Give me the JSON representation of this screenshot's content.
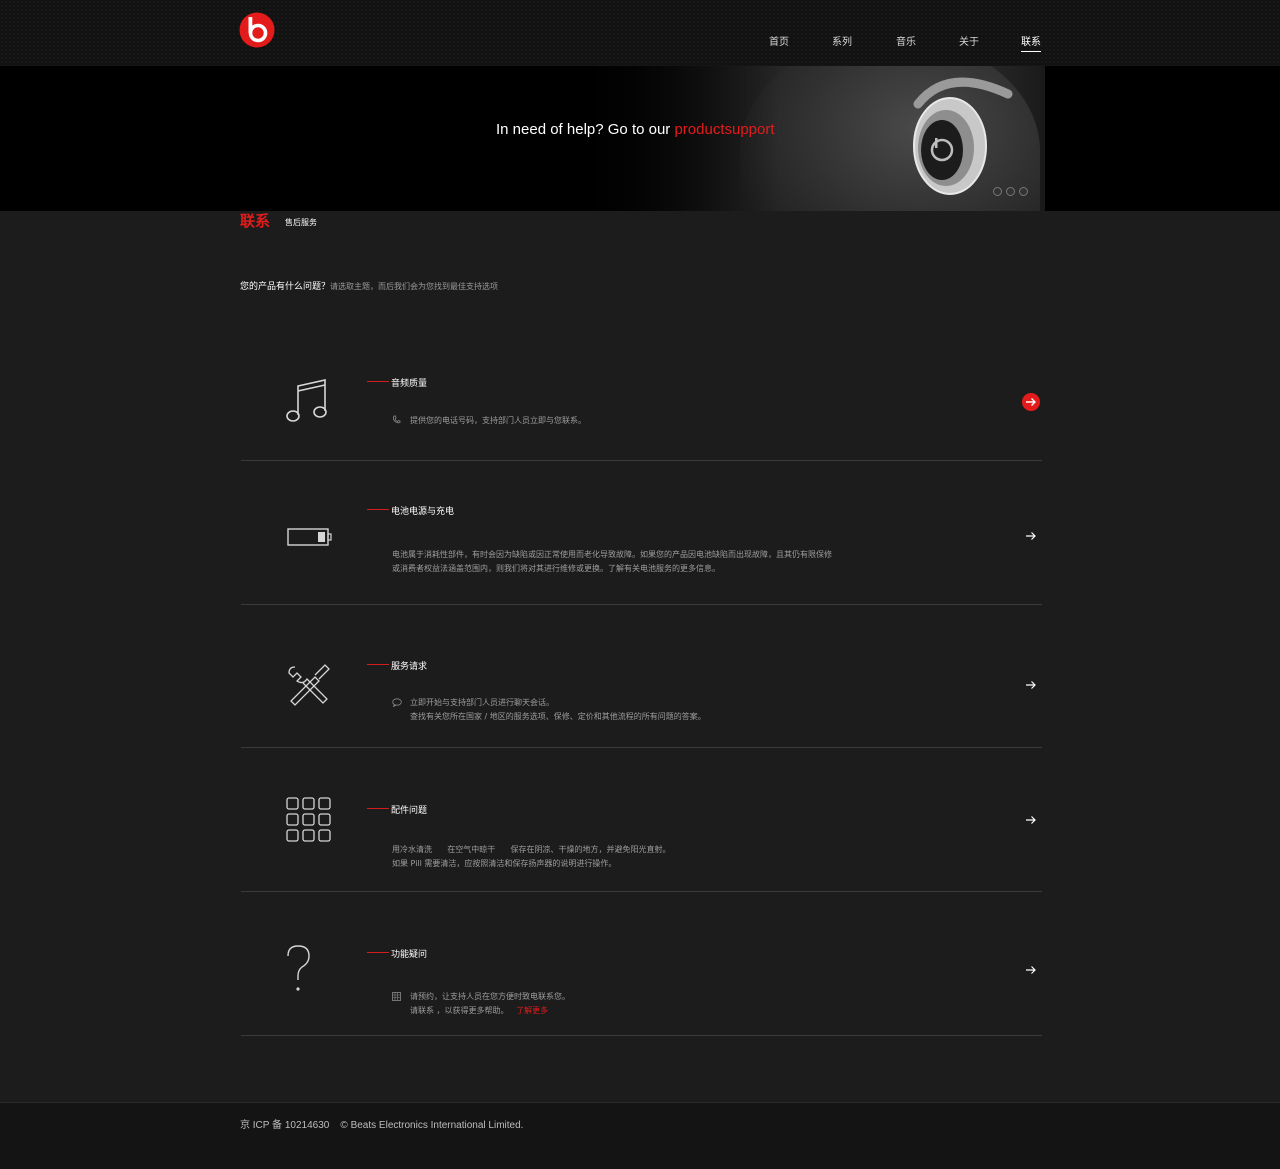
{
  "nav": {
    "items": [
      "首页",
      "系列",
      "音乐",
      "关于",
      "联系"
    ],
    "active": "联系"
  },
  "hero": {
    "text": "In need of help? Go to our ",
    "link": "productsupport"
  },
  "page": {
    "title": "联系",
    "subtitle": "售后服务",
    "question": "您的产品有什么问题？",
    "question_hint": "请选取主题，而后我们会为您找到最佳支持选项"
  },
  "sections": [
    {
      "icon": "music-note-icon",
      "title": "音频质量",
      "small_icon": "phone-icon",
      "lines": [
        "提供您的电话号码，支持部门人员立即与您联系。"
      ]
    },
    {
      "icon": "battery-icon",
      "title": "电池电源与充电",
      "lines": [
        "电池属于消耗性部件，有时会因为缺陷或因正常使用而老化导致故障。如果您的产品因电池缺陷而出现故障，且其仍有限保修",
        "或消费者权益法涵盖范围内，则我们将对其进行维修或更换。了解有关电池服务的更多信息。"
      ]
    },
    {
      "icon": "tools-icon",
      "title": "服务请求",
      "small_icon": "chat-bubble-icon",
      "lines": [
        "立即开始与支持部门人员进行聊天会话。",
        "查找有关您所在国家 / 地区的服务选项、保修、定价和其他流程的所有问题的答案。"
      ]
    },
    {
      "icon": "grid-icon",
      "title": "配件问题",
      "lines": [
        "用冷水清洗      在空气中晾干      保存在阴凉、干燥的地方，并避免阳光直射。",
        "如果 Pill 需要清洁，应按照清洁和保存扬声器的说明进行操作。"
      ]
    },
    {
      "icon": "question-mark-icon",
      "title": "功能疑问",
      "small_icon": "calendar-icon",
      "lines": [
        "请预约，让支持人员在您方便时致电联系您。",
        "请联系 ，以获得更多帮助。"
      ],
      "link": "了解更多"
    }
  ],
  "footer": {
    "text": "京 ICP 备 10214630    © Beats Electronics International Limited."
  },
  "colors": {
    "accent": "#e41b1b",
    "background": "#1c1c1c",
    "header": "#121212"
  }
}
